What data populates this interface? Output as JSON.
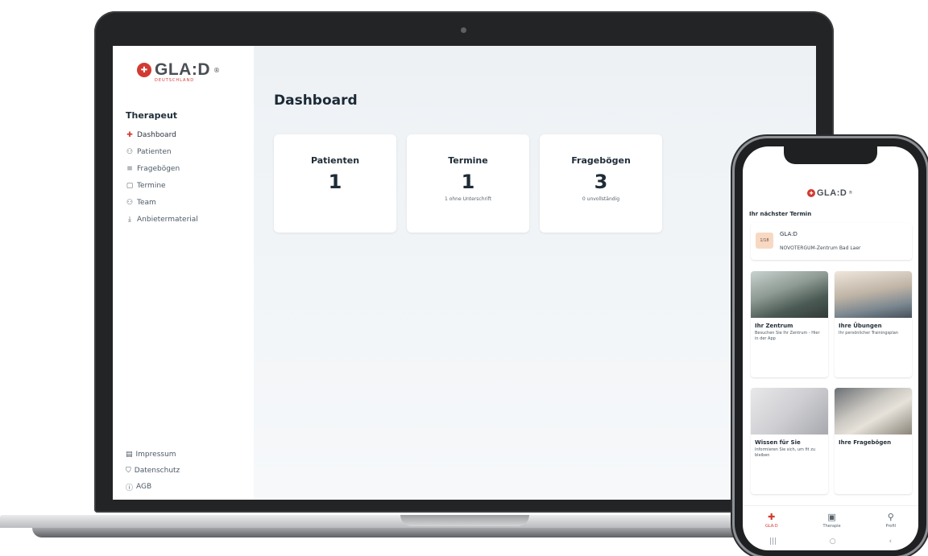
{
  "desktop": {
    "brand": "GLA:D",
    "brand_mark": "®",
    "brand_sub": "DEUTSCHLAND",
    "sidebar": {
      "heading": "Therapeut",
      "items": [
        {
          "label": "Dashboard",
          "icon": "glad-logo-icon",
          "glyph": "✚",
          "active": true
        },
        {
          "label": "Patienten",
          "icon": "users-icon",
          "glyph": "⚇"
        },
        {
          "label": "Fragebögen",
          "icon": "list-icon",
          "glyph": "≡"
        },
        {
          "label": "Termine",
          "icon": "calendar-icon",
          "glyph": "▢"
        },
        {
          "label": "Team",
          "icon": "team-icon",
          "glyph": "⚇"
        },
        {
          "label": "Anbietermaterial",
          "icon": "download-icon",
          "glyph": "⤓"
        }
      ],
      "footer_items": [
        {
          "label": "Impressum",
          "icon": "document-icon",
          "glyph": "▤"
        },
        {
          "label": "Datenschutz",
          "icon": "lock-icon",
          "glyph": "⛉"
        },
        {
          "label": "AGB",
          "icon": "info-icon",
          "glyph": "ⓘ"
        }
      ]
    },
    "main": {
      "title": "Dashboard",
      "cards": [
        {
          "title": "Patienten",
          "value": "1",
          "sub": ""
        },
        {
          "title": "Termine",
          "value": "1",
          "sub": "1 ohne Unterschrift"
        },
        {
          "title": "Fragebögen",
          "value": "3",
          "sub": "0 unvollständig"
        }
      ]
    }
  },
  "mobile": {
    "brand": "GLA:D",
    "brand_mark": "®",
    "next_appointment_heading": "Ihr nächster Termin",
    "appointment": {
      "date": "1/18",
      "title": "GLA:D",
      "location": "NOVOTERGUM-Zentrum Bad Laer"
    },
    "tiles": [
      {
        "title": "Ihr Zentrum",
        "desc": "Besuchen Sie Ihr Zentrum - Hier in der App"
      },
      {
        "title": "Ihre Übungen",
        "desc": "Ihr persönlicher Trainingsplan"
      },
      {
        "title": "Wissen für Sie",
        "desc": "Informieren Sie sich, um fit zu bleiben"
      },
      {
        "title": "Ihre Fragebögen",
        "desc": ""
      }
    ],
    "tabbar": [
      {
        "label": "GLA:D",
        "icon": "glad-logo-icon",
        "glyph": "✚",
        "active": true
      },
      {
        "label": "Therapie",
        "icon": "calendar-icon",
        "glyph": "▣"
      },
      {
        "label": "Profil",
        "icon": "person-icon",
        "glyph": "⚲"
      }
    ],
    "system_nav": [
      "|||",
      "○",
      "‹"
    ]
  },
  "colors": {
    "accent": "#d23a31",
    "background": "#eef2f5"
  }
}
